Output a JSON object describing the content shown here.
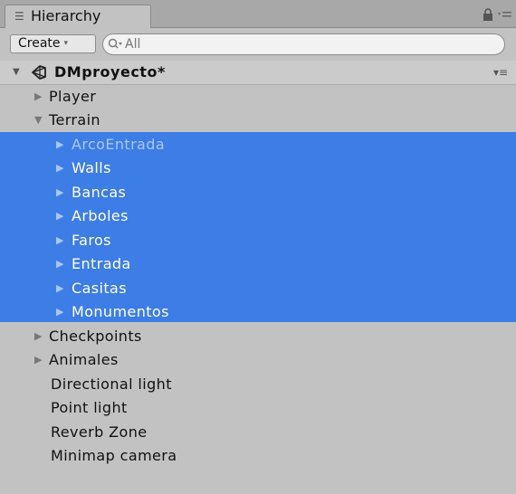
{
  "panel": {
    "tab_icon": "list-icon",
    "tab_label": "Hierarchy",
    "lock_icon": "lock-icon",
    "menu_icon": "options-menu-icon"
  },
  "toolbar": {
    "create_label": "Create",
    "create_caret": "▾",
    "search_icon": "search-icon",
    "search_value": "All"
  },
  "scene": {
    "name": "DMproyecto*",
    "expanded_glyph": "▼",
    "options_glyph": "▾≡"
  },
  "hierarchy": {
    "items": [
      {
        "label": "Player",
        "glyph": "▶"
      },
      {
        "label": "Terrain",
        "glyph": "▼"
      },
      {
        "label": "ArcoEntrada",
        "glyph": "▶"
      },
      {
        "label": "Walls",
        "glyph": "▶"
      },
      {
        "label": "Bancas",
        "glyph": "▶"
      },
      {
        "label": "Arboles",
        "glyph": "▶"
      },
      {
        "label": "Faros",
        "glyph": "▶"
      },
      {
        "label": "Entrada",
        "glyph": "▶"
      },
      {
        "label": "Casitas",
        "glyph": "▶"
      },
      {
        "label": "Monumentos",
        "glyph": "▶"
      },
      {
        "label": "Checkpoints",
        "glyph": "▶"
      },
      {
        "label": "Animales",
        "glyph": "▶"
      },
      {
        "label": "Directional light"
      },
      {
        "label": "Point light"
      },
      {
        "label": "Reverb Zone"
      },
      {
        "label": "Minimap camera"
      }
    ]
  },
  "colors": {
    "panel_bg": "#c2c2c2",
    "selection": "#3d7de6",
    "selected_text": "#ffffff"
  }
}
